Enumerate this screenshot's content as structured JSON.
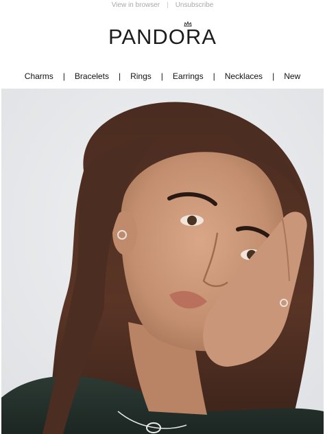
{
  "header": {
    "view_in_browser": "View in browser",
    "separator": "|",
    "unsubscribe": "Unsubscribe"
  },
  "brand": {
    "logo_text": "PANDORA",
    "logo_icon": "crown-icon"
  },
  "nav": {
    "items": [
      {
        "label": "Charms"
      },
      {
        "label": "Bracelets"
      },
      {
        "label": "Rings"
      },
      {
        "label": "Earrings"
      },
      {
        "label": "Necklaces"
      },
      {
        "label": "New"
      }
    ],
    "separator": "|"
  },
  "hero": {
    "image": "portrait-photo"
  },
  "colors": {
    "text": "#111111",
    "muted": "#a8a8a8",
    "hero_background": "#e9eaec"
  }
}
